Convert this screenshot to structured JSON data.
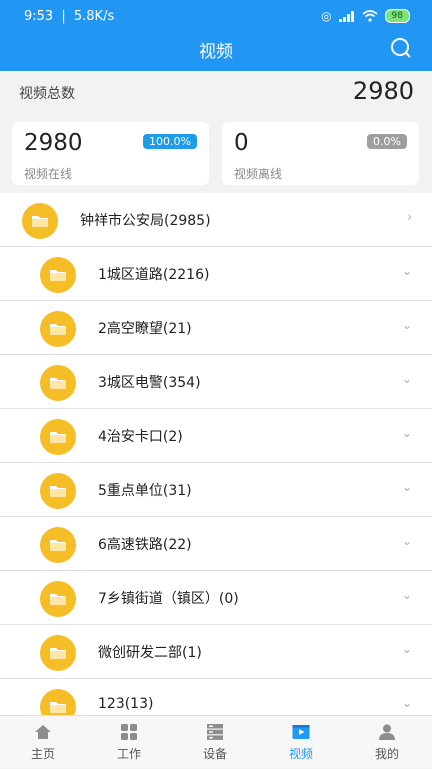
{
  "status": {
    "time": "9:53",
    "speed": "5.8K/s",
    "battery": "98"
  },
  "appbar": {
    "title": "视频"
  },
  "summary": {
    "label": "视频总数",
    "total": "2980"
  },
  "cards": [
    {
      "count": "2980",
      "percent": "100.0%",
      "caption": "视频在线",
      "color": "#1e9be9"
    },
    {
      "count": "0",
      "percent": "0.0%",
      "caption": "视频离线",
      "color": "#9e9e9e"
    }
  ],
  "list": {
    "root": {
      "label": "钟祥市公安局(2985)",
      "chevron": "›"
    },
    "children": [
      {
        "label": "1城区道路(2216)",
        "chevron": "⌄"
      },
      {
        "label": "2高空瞭望(21)",
        "chevron": "⌄"
      },
      {
        "label": "3城区电警(354)",
        "chevron": "⌄"
      },
      {
        "label": "4治安卡口(2)",
        "chevron": "⌄"
      },
      {
        "label": "5重点单位(31)",
        "chevron": "⌄"
      },
      {
        "label": "6高速铁路(22)",
        "chevron": "⌄"
      },
      {
        "label": "7乡镇街道（镇区）(0)",
        "chevron": "⌄"
      },
      {
        "label": "微创研发二部(1)",
        "chevron": "⌄"
      },
      {
        "label": "123(13)",
        "chevron": "⌄"
      }
    ]
  },
  "tabs": [
    {
      "label": "主页",
      "icon": "home-icon"
    },
    {
      "label": "工作",
      "icon": "grid-icon"
    },
    {
      "label": "设备",
      "icon": "server-icon"
    },
    {
      "label": "视频",
      "icon": "video-icon",
      "active": true
    },
    {
      "label": "我的",
      "icon": "user-icon"
    }
  ],
  "colors": {
    "primary": "#2196f3",
    "folder": "#f5be26"
  }
}
